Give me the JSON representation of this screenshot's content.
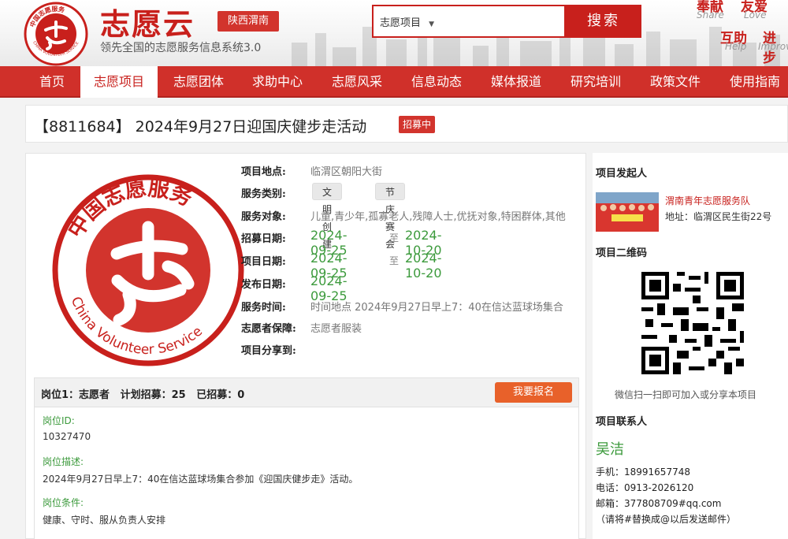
{
  "header": {
    "logo_ring_text": "中国志愿服务",
    "logo_ring_text_en": "CHINA VOLUNTEER SERVICE",
    "brand": "志愿云",
    "region": "陕西渭南",
    "tagline": "领先全国的志愿服务信息系统3.0",
    "search_category": "志愿项目",
    "search_button": "搜索",
    "slogans": [
      {
        "zh": "奉献",
        "en": "Share"
      },
      {
        "zh": "友爱",
        "en": "Love"
      },
      {
        "zh": "互助",
        "en": "Help"
      },
      {
        "zh": "进步",
        "en": "Improve"
      }
    ]
  },
  "nav": {
    "items": [
      "首页",
      "志愿项目",
      "志愿团体",
      "求助中心",
      "志愿风采",
      "信息动态",
      "媒体报道",
      "研究培训",
      "政策文件",
      "使用指南"
    ],
    "active": "志愿项目"
  },
  "project": {
    "title": "【8811684】 2024年9月27日迎国庆健步走活动",
    "status": "招募中",
    "logo_text_top": "中国志愿服务",
    "logo_text_bottom": "China Volunteer Service",
    "fields": {
      "location_label": "项目地点:",
      "location": "临渭区朝阳大街",
      "category_label": "服务类别:",
      "categories": [
        "文明创建",
        "节庆赛会"
      ],
      "target_label": "服务对象:",
      "target": "儿童,青少年,孤寡老人,残障人士,优抚对象,特困群体,其他",
      "recruit_date_label": "招募日期:",
      "recruit_start": "2024-09-25",
      "recruit_end": "2024-10-20",
      "project_date_label": "项目日期:",
      "project_start": "2024-09-25",
      "project_end": "2024-10-20",
      "to": "至",
      "publish_date_label": "发布日期:",
      "publish_date": "2024-09-25",
      "service_time_label": "服务时间:",
      "service_time": "时间地点 2024年9月27日早上7：40在信达蓝球场集合",
      "guarantee_label": "志愿者保障:",
      "guarantee": "志愿者服装",
      "share_label": "项目分享到:"
    },
    "job": {
      "header": "岗位1：志愿者   计划招募：25   已招募：0",
      "signup": "我要报名",
      "id_label": "岗位ID:",
      "id": "10327470",
      "desc_label": "岗位描述:",
      "desc": "2024年9月27日早上7：40在信达蓝球场集合参加《迎国庆健步走》活动。",
      "cond_label": "岗位条件:",
      "cond": "健康、守时、服从负责人安排"
    }
  },
  "sidebar": {
    "initiator_title": "项目发起人",
    "org_name": "渭南青年志愿服务队",
    "org_address": "地址：临渭区民生街22号",
    "qr_title": "项目二维码",
    "qr_caption": "微信扫一扫即可加入或分享本项目",
    "contact_title": "项目联系人",
    "contact_name": "吴洁",
    "phone": "手机：18991657748",
    "tel": "电话：0913-2026120",
    "email": "邮箱：377808709#qq.com",
    "email_note": "（请将#替换成@以后发送邮件）"
  },
  "colors": {
    "brand_red": "#c8201c",
    "nav_red": "#d0302a",
    "orange_button": "#e8612a",
    "green_text": "#3c9a3c"
  }
}
